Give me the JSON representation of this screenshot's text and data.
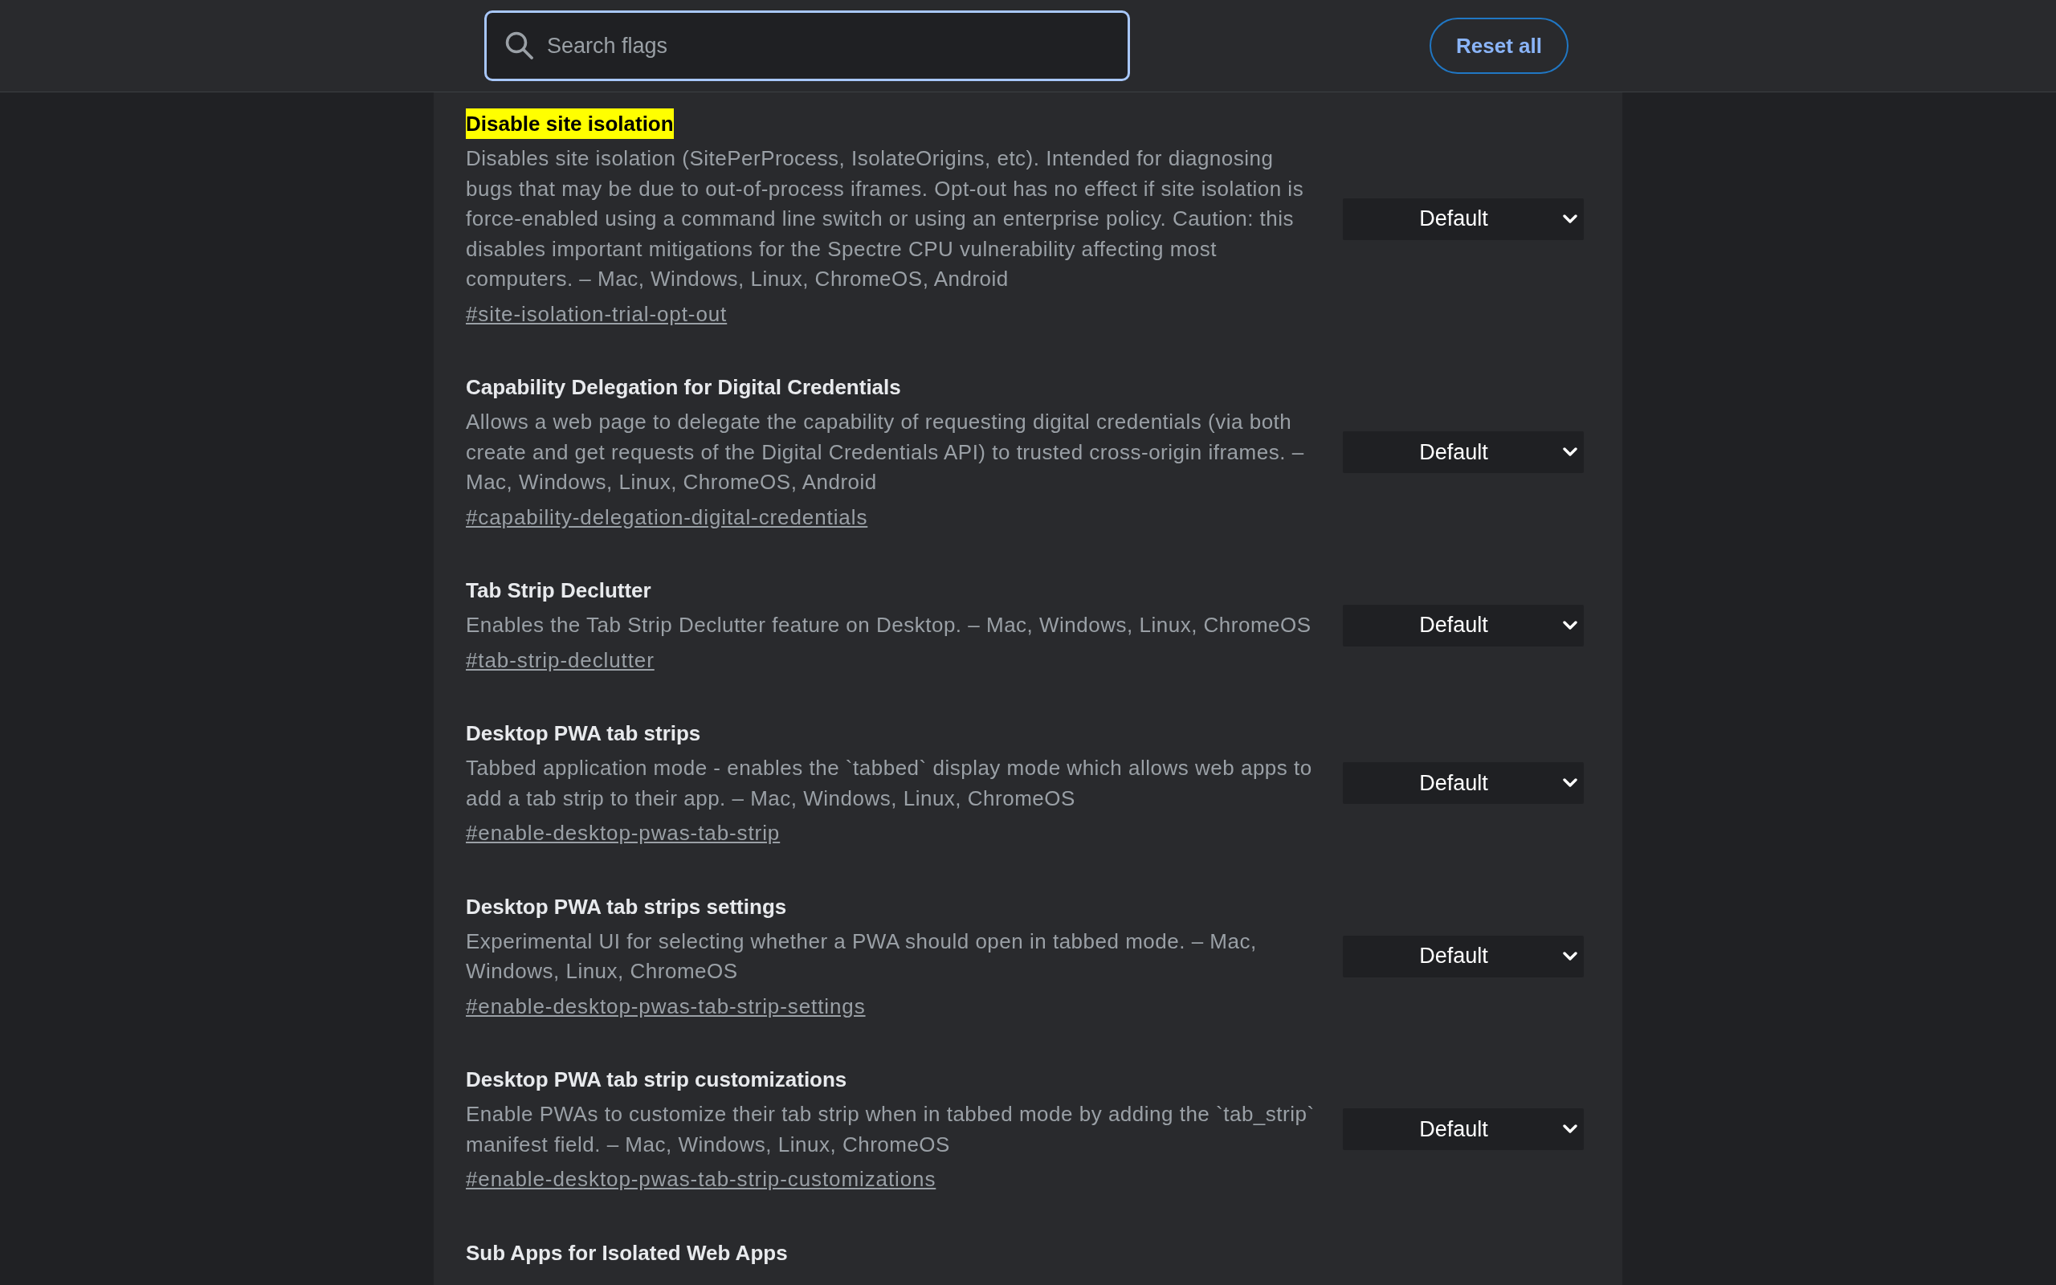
{
  "header": {
    "search": {
      "placeholder": "Search flags",
      "focused": true
    },
    "reset_button": "Reset all"
  },
  "flags": [
    {
      "title": "Disable site isolation",
      "highlighted": true,
      "description": "Disables site isolation (SitePerProcess, IsolateOrigins, etc). Intended for diagnosing bugs that may be due to out-of-process iframes. Opt-out has no effect if site isolation is force-enabled using a command line switch or using an enterprise policy. Caution: this disables important mitigations for the Spectre CPU vulnerability affecting most computers. – Mac, Windows, Linux, ChromeOS, Android",
      "link": "#site-isolation-trial-opt-out",
      "select": "Default"
    },
    {
      "title": "Capability Delegation for Digital Credentials",
      "highlighted": false,
      "description": "Allows a web page to delegate the capability of requesting digital credentials (via both create and get requests of the Digital Credentials API) to trusted cross-origin iframes. – Mac, Windows, Linux, ChromeOS, Android",
      "link": "#capability-delegation-digital-credentials",
      "select": "Default"
    },
    {
      "title": "Tab Strip Declutter",
      "highlighted": false,
      "description": "Enables the Tab Strip Declutter feature on Desktop. – Mac, Windows, Linux, ChromeOS",
      "link": "#tab-strip-declutter",
      "select": "Default"
    },
    {
      "title": "Desktop PWA tab strips",
      "highlighted": false,
      "description": "Tabbed application mode - enables the `tabbed` display mode which allows web apps to add a tab strip to their app. – Mac, Windows, Linux, ChromeOS",
      "link": "#enable-desktop-pwas-tab-strip",
      "select": "Default"
    },
    {
      "title": "Desktop PWA tab strips settings",
      "highlighted": false,
      "description": "Experimental UI for selecting whether a PWA should open in tabbed mode. – Mac, Windows, Linux, ChromeOS",
      "link": "#enable-desktop-pwas-tab-strip-settings",
      "select": "Default"
    },
    {
      "title": "Desktop PWA tab strip customizations",
      "highlighted": false,
      "description": "Enable PWAs to customize their tab strip when in tabbed mode by adding the `tab_strip` manifest field. – Mac, Windows, Linux, ChromeOS",
      "link": "#enable-desktop-pwas-tab-strip-customizations",
      "select": "Default"
    },
    {
      "title": "Sub Apps for Isolated Web Apps",
      "highlighted": false
    }
  ]
}
